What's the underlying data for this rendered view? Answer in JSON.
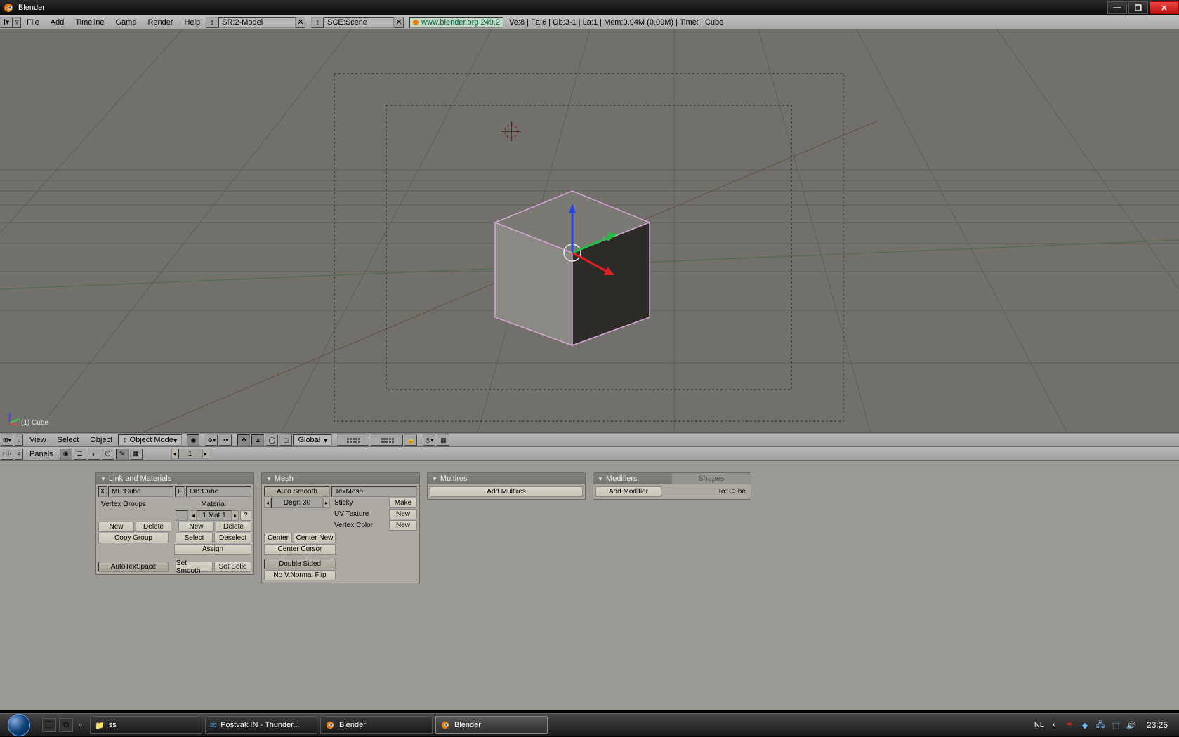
{
  "window": {
    "title": "Blender"
  },
  "header": {
    "menus": [
      "File",
      "Add",
      "Timeline",
      "Game",
      "Render",
      "Help"
    ],
    "sr_field": "SR:2-Model",
    "sce_field": "SCE:Scene",
    "link_text": "www.blender.org 249.2",
    "stats": "Ve:8 | Fa:6 | Ob:3-1 | La:1 | Mem:0.94M (0.09M) | Time: | Cube"
  },
  "viewport": {
    "label": "(1) Cube"
  },
  "vpheader": {
    "menus": [
      "View",
      "Select",
      "Object"
    ],
    "mode": "Object Mode",
    "orient": "Global"
  },
  "bwheader": {
    "label": "Panels",
    "frame": "1"
  },
  "panels": {
    "link": {
      "title": "Link and Materials",
      "me": "ME:Cube",
      "f": "F",
      "ob": "OB:Cube",
      "vgroups": "Vertex Groups",
      "material": "Material",
      "matidx": "1 Mat 1",
      "q": "?",
      "new": "New",
      "delete": "Delete",
      "copygroup": "Copy Group",
      "new2": "New",
      "delete2": "Delete",
      "select": "Select",
      "deselect": "Deselect",
      "assign": "Assign",
      "autotex": "AutoTexSpace",
      "setsmooth": "Set Smooth",
      "setsolid": "Set Solid"
    },
    "mesh": {
      "title": "Mesh",
      "autosmooth": "Auto Smooth",
      "degr": "Degr: 30",
      "texmesh": "TexMesh:",
      "sticky": "Sticky",
      "make": "Make",
      "uv": "UV Texture",
      "new1": "New",
      "vcolor": "Vertex Color",
      "new2": "New",
      "center": "Center",
      "centernew": "Center New",
      "centercursor": "Center Cursor",
      "doublesided": "Double Sided",
      "novnormal": "No V.Normal Flip"
    },
    "multires": {
      "title": "Multires",
      "add": "Add Multires"
    },
    "modifiers": {
      "title": "Modifiers",
      "shapes": "Shapes",
      "add": "Add Modifier",
      "to": "To: Cube"
    }
  },
  "taskbar": {
    "tasks": [
      {
        "label": "ss"
      },
      {
        "label": "Postvak IN - Thunder..."
      },
      {
        "label": "Blender"
      },
      {
        "label": "Blender"
      }
    ],
    "lang": "NL",
    "clock": "23:25"
  }
}
